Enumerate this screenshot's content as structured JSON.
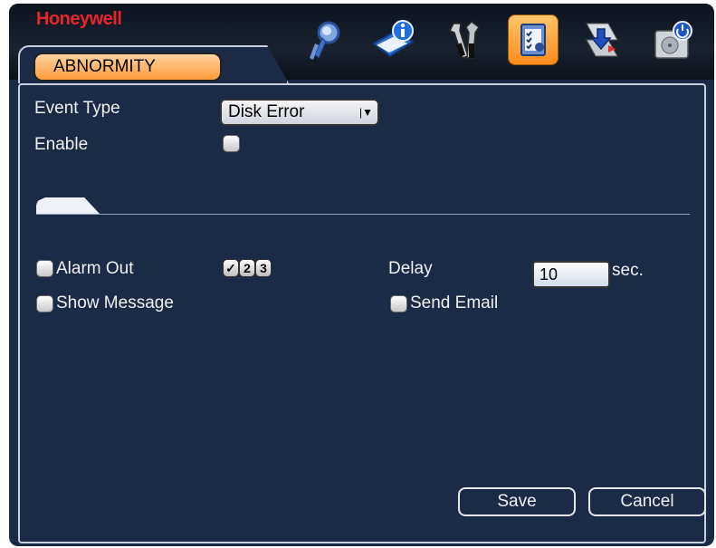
{
  "brand": "Honeywell",
  "tab_label": "ABNORMITY",
  "nav_icons": [
    {
      "name": "search-nav-icon"
    },
    {
      "name": "info-nav-icon"
    },
    {
      "name": "tools-nav-icon"
    },
    {
      "name": "abnormity-nav-icon"
    },
    {
      "name": "backup-nav-icon"
    },
    {
      "name": "shutdown-nav-icon"
    }
  ],
  "form": {
    "event_type_label": "Event Type",
    "event_type_value": "Disk Error",
    "enable_label": "Enable",
    "enable_checked": false
  },
  "actions": {
    "alarm_out_label": "Alarm Out",
    "alarm_out_checked": false,
    "channels": [
      "1",
      "2",
      "3"
    ],
    "channel_selected": "1",
    "delay_label": "Delay",
    "delay_value": "10",
    "delay_unit": "sec.",
    "show_message_label": "Show Message",
    "show_message_checked": false,
    "send_email_label": "Send Email",
    "send_email_checked": false
  },
  "buttons": {
    "save": "Save",
    "cancel": "Cancel"
  }
}
